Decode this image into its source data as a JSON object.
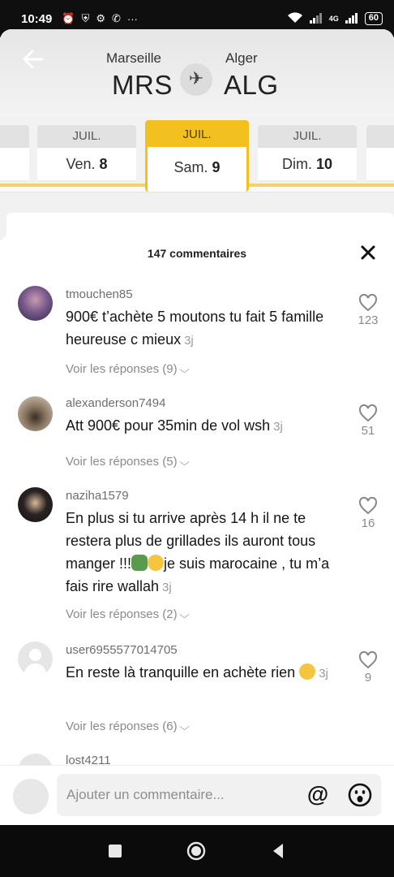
{
  "status_bar": {
    "time": "10:49",
    "network": "4G",
    "battery": "60"
  },
  "flight": {
    "origin_city": "Marseille",
    "origin_code": "MRS",
    "destination_city": "Alger",
    "destination_code": "ALG"
  },
  "dates": [
    {
      "month": "JUIL.",
      "day_name": "Ven.",
      "day_num": "8",
      "selected": false
    },
    {
      "month": "JUIL.",
      "day_name": "Sam.",
      "day_num": "9",
      "selected": true
    },
    {
      "month": "JUIL.",
      "day_name": "Dim.",
      "day_num": "10",
      "selected": false
    }
  ],
  "comments_panel": {
    "title": "147 commentaires"
  },
  "comments": [
    {
      "username": "tmouchen85",
      "text": "900€ t’achète 5 moutons tu fait 5 famille heureuse c mieux",
      "time": "3j",
      "replies": "Voir les réponses (9)",
      "likes": "123"
    },
    {
      "username": "alexanderson7494",
      "text": "Att 900€ pour 35min de vol wsh",
      "time": "3j",
      "replies": "Voir les réponses (5)",
      "likes": "51"
    },
    {
      "username": "naziha1579",
      "text_a": "En plus si tu arrive après 14 h il ne te restera plus de grillades ils auront tous manger !!!",
      "text_b": "je suis marocaine , tu m’a fais rire wallah",
      "time": "3j",
      "replies": "Voir les réponses (2)",
      "likes": "16"
    },
    {
      "username": "user6955577014705",
      "text": "En reste là tranquille en achète rien",
      "time": "3j",
      "replies": "Voir les réponses (6)",
      "likes": "9"
    },
    {
      "username": "lost4211"
    }
  ],
  "comment_input": {
    "placeholder": "Ajouter un commentaire..."
  },
  "colors": {
    "accent_yellow": "#f3c11f",
    "text_primary": "#161616",
    "text_secondary": "#8a8a8a"
  }
}
